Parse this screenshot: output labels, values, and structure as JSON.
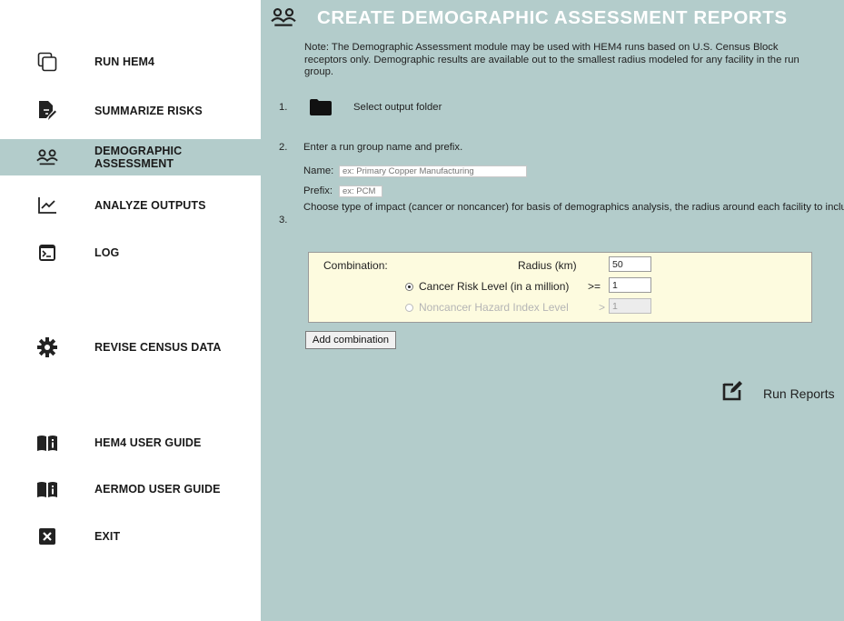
{
  "sidebar": {
    "items": [
      {
        "label": "RUN HEM4",
        "icon": "copy-windows-icon"
      },
      {
        "label": "SUMMARIZE RISKS",
        "icon": "file-edit-icon"
      },
      {
        "label": "DEMOGRAPHIC ASSESSMENT",
        "icon": "people-group-icon",
        "active": true
      },
      {
        "label": "ANALYZE OUTPUTS",
        "icon": "line-chart-icon"
      },
      {
        "label": "LOG",
        "icon": "terminal-icon"
      },
      {
        "label": "REVISE CENSUS DATA",
        "icon": "gear-icon"
      },
      {
        "label": "HEM4 USER GUIDE",
        "icon": "book-info-icon"
      },
      {
        "label": "AERMOD USER GUIDE",
        "icon": "book-info-icon"
      },
      {
        "label": "EXIT",
        "icon": "close-box-icon"
      }
    ]
  },
  "main": {
    "title": "CREATE DEMOGRAPHIC ASSESSMENT REPORTS",
    "note": "Note: The Demographic Assessment module may be used with HEM4 runs based on U.S. Census Block receptors only. Demographic results are available out to the smallest radius modeled for any facility in the run group.",
    "steps": {
      "step1_num": "1.",
      "step1_text": "Select output folder",
      "step2_num": "2.",
      "step2_text": "Enter a run group name and prefix.",
      "name_label": "Name:",
      "name_placeholder": "ex: Primary Copper Manufacturing",
      "prefix_label": "Prefix:",
      "prefix_placeholder": "ex: PCM",
      "step3_num": "3.",
      "step3_text": "Choose type of impact (cancer or noncancer) for basis of demographics analysis, the radius around each facility to include, and the impact level at which population percentages will be calculated. Note: proximity statistics will be included at your specified radius."
    },
    "combination": {
      "label": "Combination:",
      "radius_label": "Radius (km)",
      "radius_value": "50",
      "cancer_label": "Cancer Risk Level (in a million)",
      "cancer_op": ">=",
      "cancer_value": "1",
      "noncancer_label": "Noncancer Hazard Index Level",
      "noncancer_op": ">",
      "noncancer_value": "1"
    },
    "add_combination_label": "Add combination",
    "run_reports_label": "Run Reports"
  },
  "colors": {
    "main_bg": "#b3cccb",
    "active_nav_bg": "#b3cccb",
    "combo_bg": "#fdfbdf",
    "title_color": "#ffffff"
  }
}
